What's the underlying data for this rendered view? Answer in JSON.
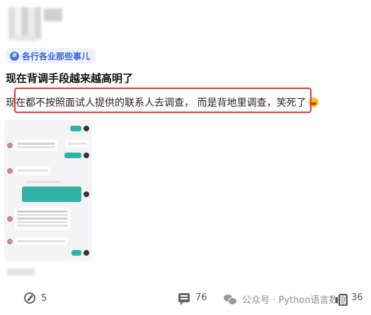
{
  "post": {
    "tag": "各行各业那些事儿",
    "tag_icon": "hash-icon",
    "title": "现在背调手段越来越高明了",
    "body_before": "现",
    "body_highlight": "在都不按照面试人提供的联系人去调查， 而是背地里调查，",
    "body_after": "笑死了",
    "emoji": "laughing-emoji"
  },
  "footer": {
    "edit_count": "5",
    "comment_count": "76",
    "watermark": "公众号 · Python语言数据",
    "like_count": "36"
  },
  "colors": {
    "highlight_border": "#e53935",
    "tag_blue": "#3c63d6",
    "chat_teal": "#33b3a6"
  }
}
